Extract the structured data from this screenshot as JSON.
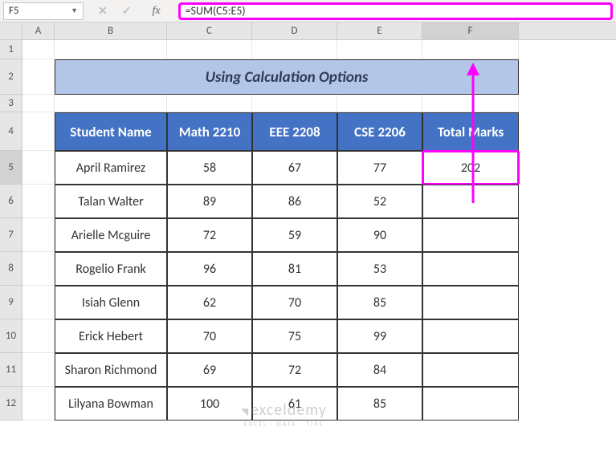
{
  "name_box": "F5",
  "formula_bar": "=SUM(C5:E5)",
  "columns": [
    "A",
    "B",
    "C",
    "D",
    "E",
    "F"
  ],
  "row_numbers": [
    1,
    2,
    3,
    4,
    5,
    6,
    7,
    8,
    9,
    10,
    11,
    12
  ],
  "title": "Using Calculation Options",
  "headers": {
    "student": "Student Name",
    "math": "Math 2210",
    "eee": "EEE 2208",
    "cse": "CSE 2206",
    "total": "Total Marks"
  },
  "rows": [
    {
      "name": "April Ramirez",
      "math": "58",
      "eee": "67",
      "cse": "77",
      "total": "202"
    },
    {
      "name": "Talan Walter",
      "math": "89",
      "eee": "86",
      "cse": "52",
      "total": ""
    },
    {
      "name": "Arielle Mcguire",
      "math": "72",
      "eee": "59",
      "cse": "90",
      "total": ""
    },
    {
      "name": "Rogelio Frank",
      "math": "96",
      "eee": "81",
      "cse": "53",
      "total": ""
    },
    {
      "name": "Isiah Glenn",
      "math": "62",
      "eee": "70",
      "cse": "85",
      "total": ""
    },
    {
      "name": "Erick Hebert",
      "math": "70",
      "eee": "75",
      "cse": "99",
      "total": ""
    },
    {
      "name": "Sharon Richmond",
      "math": "69",
      "eee": "72",
      "cse": "84",
      "total": ""
    },
    {
      "name": "Lilyana Bowman",
      "math": "100",
      "eee": "61",
      "cse": "85",
      "total": ""
    }
  ],
  "watermark_big": "exceldemy",
  "watermark_small": "EXCEL · DATA · TIPS",
  "chart_data": {
    "type": "table",
    "title": "Using Calculation Options",
    "columns": [
      "Student Name",
      "Math 2210",
      "EEE 2208",
      "CSE 2206",
      "Total Marks"
    ],
    "rows": [
      [
        "April Ramirez",
        58,
        67,
        77,
        202
      ],
      [
        "Talan Walter",
        89,
        86,
        52,
        null
      ],
      [
        "Arielle Mcguire",
        72,
        59,
        90,
        null
      ],
      [
        "Rogelio Frank",
        96,
        81,
        53,
        null
      ],
      [
        "Isiah Glenn",
        62,
        70,
        85,
        null
      ],
      [
        "Erick Hebert",
        70,
        75,
        99,
        null
      ],
      [
        "Sharon Richmond",
        69,
        72,
        84,
        null
      ],
      [
        "Lilyana Bowman",
        100,
        61,
        85,
        null
      ]
    ]
  }
}
